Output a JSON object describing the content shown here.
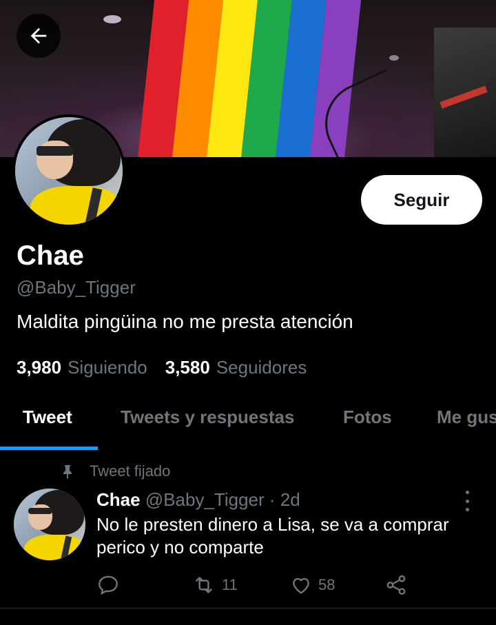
{
  "header": {
    "back_icon": "arrow-left-icon"
  },
  "banner": {
    "flag_colors": [
      "#e0202a",
      "#ff8c00",
      "#ffe812",
      "#1fa94a",
      "#1a6fd1",
      "#8a3fbf"
    ]
  },
  "profile": {
    "display_name": "Chae",
    "handle": "@Baby_Tigger",
    "bio": "Maldita pingüina no me presta atención",
    "follow_label": "Seguir",
    "following_count": "3,980",
    "following_label": "Siguiendo",
    "followers_count": "3,580",
    "followers_label": "Seguidores"
  },
  "tabs": [
    {
      "label": "Tweet",
      "active": true
    },
    {
      "label": "Tweets y respuestas",
      "active": false
    },
    {
      "label": "Fotos",
      "active": false
    },
    {
      "label": "Me gus",
      "active": false
    }
  ],
  "pinned_tweet": {
    "pinned_label": "Tweet fijado",
    "author_name": "Chae",
    "author_handle": "@Baby_Tigger",
    "separator": "·",
    "time": "2d",
    "text": "No le presten dinero a Lisa, se va a comprar perico y no comparte",
    "reply_count": "",
    "retweet_count": "11",
    "like_count": "58"
  },
  "colors": {
    "accent": "#1d9bf0",
    "muted_text": "#6e767d",
    "background": "#000000"
  }
}
